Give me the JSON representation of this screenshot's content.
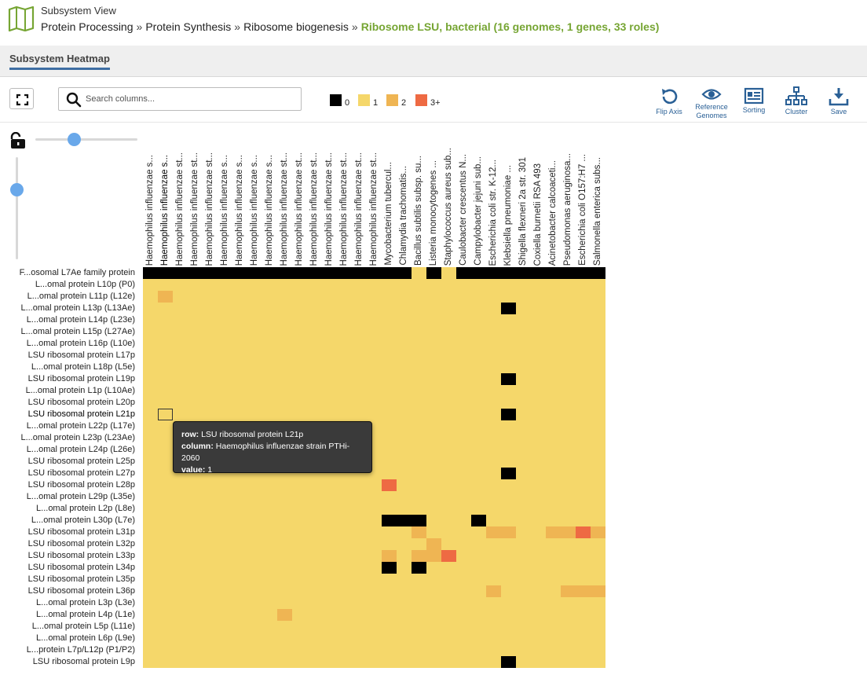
{
  "header": {
    "title": "Subsystem View",
    "breadcrumb": [
      "Protein Processing",
      "Protein Synthesis",
      "Ribosome biogenesis"
    ],
    "breadcrumb_sep": "»",
    "current": "Ribosome LSU, bacterial (16 genomes, 1 genes, 33 roles)"
  },
  "tab": {
    "label": "Subsystem Heatmap"
  },
  "search": {
    "placeholder": "Search columns..."
  },
  "legend": [
    {
      "label": "0",
      "color": "#000000"
    },
    {
      "label": "1",
      "color": "#f5d76a"
    },
    {
      "label": "2",
      "color": "#efb553"
    },
    {
      "label": "3+",
      "color": "#ee6a43"
    }
  ],
  "toolbar": {
    "flip_axis": "Flip Axis",
    "reference_line1": "Reference",
    "reference_line2": "Genomes",
    "sorting": "Sorting",
    "cluster": "Cluster",
    "save": "Save"
  },
  "colors": {
    "accent": "#76a533",
    "tab_underline": "#3e6ea3",
    "link": "#2a6096"
  },
  "columns": [
    "Haemophilus influenzae s...",
    "Haemophilus influenzae s...",
    "Haemophilus influenzae st...",
    "Haemophilus influenzae st...",
    "Haemophilus influenzae st...",
    "Haemophilus influenzae s...",
    "Haemophilus influenzae s...",
    "Haemophilus influenzae s...",
    "Haemophilus influenzae s...",
    "Haemophilus influenzae st...",
    "Haemophilus influenzae st...",
    "Haemophilus influenzae st...",
    "Haemophilus influenzae st...",
    "Haemophilus influenzae st...",
    "Haemophilus influenzae st...",
    "Haemophilus influenzae st...",
    "Mycobacterium tubercul...",
    "Chlamydia trachomatis...",
    "Bacillus subtilis subsp. su...",
    "Listeria monocytogenes ...",
    "Staphylococcus aureus sub...",
    "Caulobacter crescentus N...",
    "Campylobacter jejuni sub...",
    "Escherichia coli str. K-12...",
    "Klebsiella pneumoniae ...",
    "Shigella flexneri 2a str. 301",
    "Coxiella burnetii RSA 493",
    "Acinetobacter calcoaceti...",
    "Pseudomonas aeruginosa...",
    "Escherichia coli O157:H7 ...",
    "Salmonella enterica subs..."
  ],
  "rows": [
    "F...osomal L7Ae family protein",
    "L...omal protein L10p (P0)",
    "L...omal protein L11p (L12e)",
    "L...omal protein L13p (L13Ae)",
    "L...omal protein L14p (L23e)",
    "L...omal protein L15p (L27Ae)",
    "L...omal protein L16p (L10e)",
    "LSU ribosomal protein L17p",
    "L...omal protein L18p (L5e)",
    "LSU ribosomal protein L19p",
    "L...omal protein L1p (L10Ae)",
    "LSU ribosomal protein L20p",
    "LSU ribosomal protein L21p",
    "L...omal protein L22p (L17e)",
    "L...omal protein L23p (L23Ae)",
    "L...omal protein L24p (L26e)",
    "LSU ribosomal protein L25p",
    "LSU ribosomal protein L27p",
    "LSU ribosomal protein L28p",
    "L...omal protein L29p (L35e)",
    "L...omal protein L2p (L8e)",
    "L...omal protein L30p (L7e)",
    "LSU ribosomal protein L31p",
    "LSU ribosomal protein L32p",
    "LSU ribosomal protein L33p",
    "LSU ribosomal protein L34p",
    "LSU ribosomal protein L35p",
    "LSU ribosomal protein L36p",
    "L...omal protein L3p (L3e)",
    "L...omal protein L4p (L1e)",
    "L...omal protein L5p (L11e)",
    "L...omal protein L6p (L9e)",
    "L...protein L7p/L12p (P1/P2)",
    "LSU ribosomal protein L9p"
  ],
  "active_row": 12,
  "active_column": 1,
  "default_value": 1,
  "cells": [
    [
      0,
      0,
      0
    ],
    [
      0,
      1,
      0
    ],
    [
      0,
      2,
      0
    ],
    [
      0,
      3,
      0
    ],
    [
      0,
      4,
      0
    ],
    [
      0,
      5,
      0
    ],
    [
      0,
      6,
      0
    ],
    [
      0,
      7,
      0
    ],
    [
      0,
      8,
      0
    ],
    [
      0,
      9,
      0
    ],
    [
      0,
      10,
      0
    ],
    [
      0,
      11,
      0
    ],
    [
      0,
      12,
      0
    ],
    [
      0,
      13,
      0
    ],
    [
      0,
      14,
      0
    ],
    [
      0,
      15,
      0
    ],
    [
      0,
      16,
      0
    ],
    [
      0,
      17,
      0
    ],
    [
      0,
      19,
      0
    ],
    [
      0,
      21,
      0
    ],
    [
      0,
      22,
      0
    ],
    [
      0,
      23,
      0
    ],
    [
      0,
      24,
      0
    ],
    [
      0,
      25,
      0
    ],
    [
      0,
      26,
      0
    ],
    [
      0,
      27,
      0
    ],
    [
      0,
      28,
      0
    ],
    [
      0,
      29,
      0
    ],
    [
      0,
      30,
      0
    ],
    [
      2,
      1,
      2
    ],
    [
      3,
      24,
      0
    ],
    [
      9,
      24,
      0
    ],
    [
      12,
      24,
      0
    ],
    [
      17,
      24,
      0
    ],
    [
      18,
      16,
      3
    ],
    [
      21,
      16,
      0
    ],
    [
      21,
      17,
      0
    ],
    [
      21,
      18,
      0
    ],
    [
      21,
      22,
      0
    ],
    [
      22,
      18,
      2
    ],
    [
      22,
      23,
      2
    ],
    [
      22,
      24,
      2
    ],
    [
      22,
      27,
      2
    ],
    [
      22,
      28,
      2
    ],
    [
      22,
      29,
      3
    ],
    [
      22,
      30,
      2
    ],
    [
      23,
      19,
      2
    ],
    [
      24,
      16,
      2
    ],
    [
      24,
      18,
      2
    ],
    [
      24,
      19,
      2
    ],
    [
      24,
      20,
      3
    ],
    [
      25,
      16,
      0
    ],
    [
      25,
      18,
      0
    ],
    [
      27,
      23,
      2
    ],
    [
      27,
      28,
      2
    ],
    [
      27,
      29,
      2
    ],
    [
      27,
      30,
      2
    ],
    [
      29,
      9,
      2
    ],
    [
      33,
      24,
      0
    ]
  ],
  "tooltip": {
    "row_key": "row:",
    "row_value": "LSU ribosomal protein L21p",
    "column_key": "column:",
    "column_value": "Haemophilus influenzae strain PTHi-2060",
    "value_key": "value:",
    "value_value": "1"
  }
}
